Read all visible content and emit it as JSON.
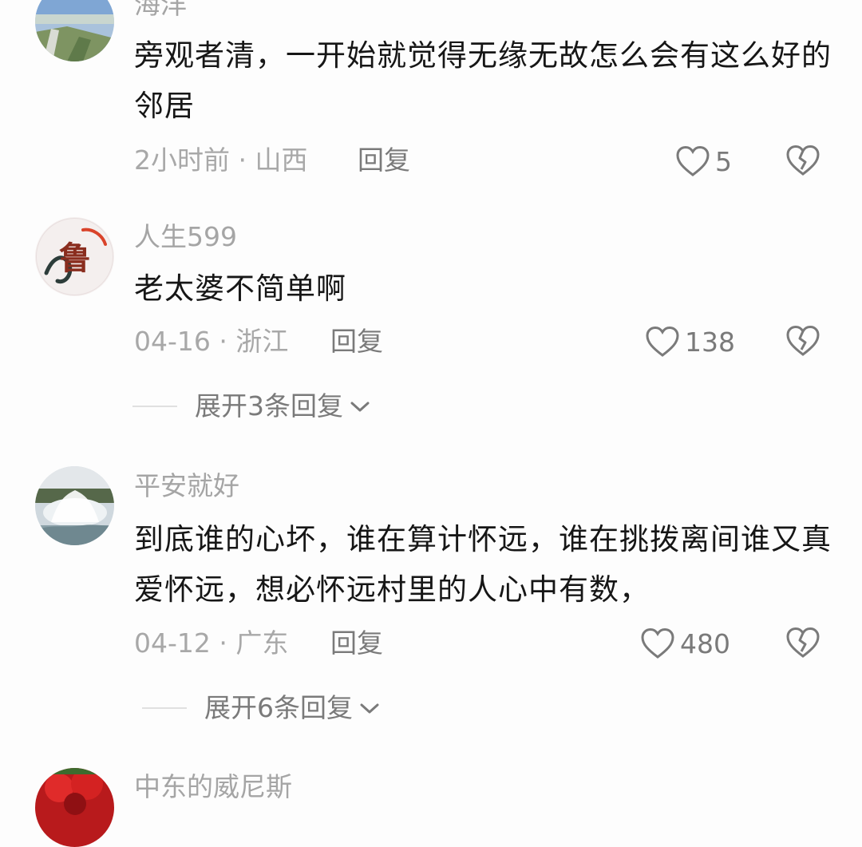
{
  "comments": [
    {
      "username": "海洋",
      "text": "旁观者清，一开始就觉得无缘无故怎么会有这么好的邻居",
      "time": "2小时前",
      "location": "山西",
      "reply_label": "回复",
      "likes": "5"
    },
    {
      "username": "人生599",
      "text": "老太婆不简单啊",
      "time": "04-16",
      "location": "浙江",
      "reply_label": "回复",
      "likes": "138",
      "expand_label": "展开3条回复"
    },
    {
      "username": "平安就好",
      "text": "到底谁的心坏，谁在算计怀远，谁在挑拨离间谁又真爱怀远，想必怀远村里的人心中有数，",
      "time": "04-12",
      "location": "广东",
      "reply_label": "回复",
      "likes": "480",
      "expand_label": "展开6条回复"
    },
    {
      "username": "中东的威尼斯"
    }
  ],
  "separator": " · ",
  "avatars": {
    "0": "landscape-avatar",
    "1": "calligraphy-avatar",
    "2": "fountain-avatar",
    "3": "red-flower-avatar"
  },
  "avatar_text": {
    "1": "鲁"
  },
  "colors": {
    "username": "#a5a5a5",
    "meta": "#a8a8a8",
    "action": "#7a7a7a"
  }
}
